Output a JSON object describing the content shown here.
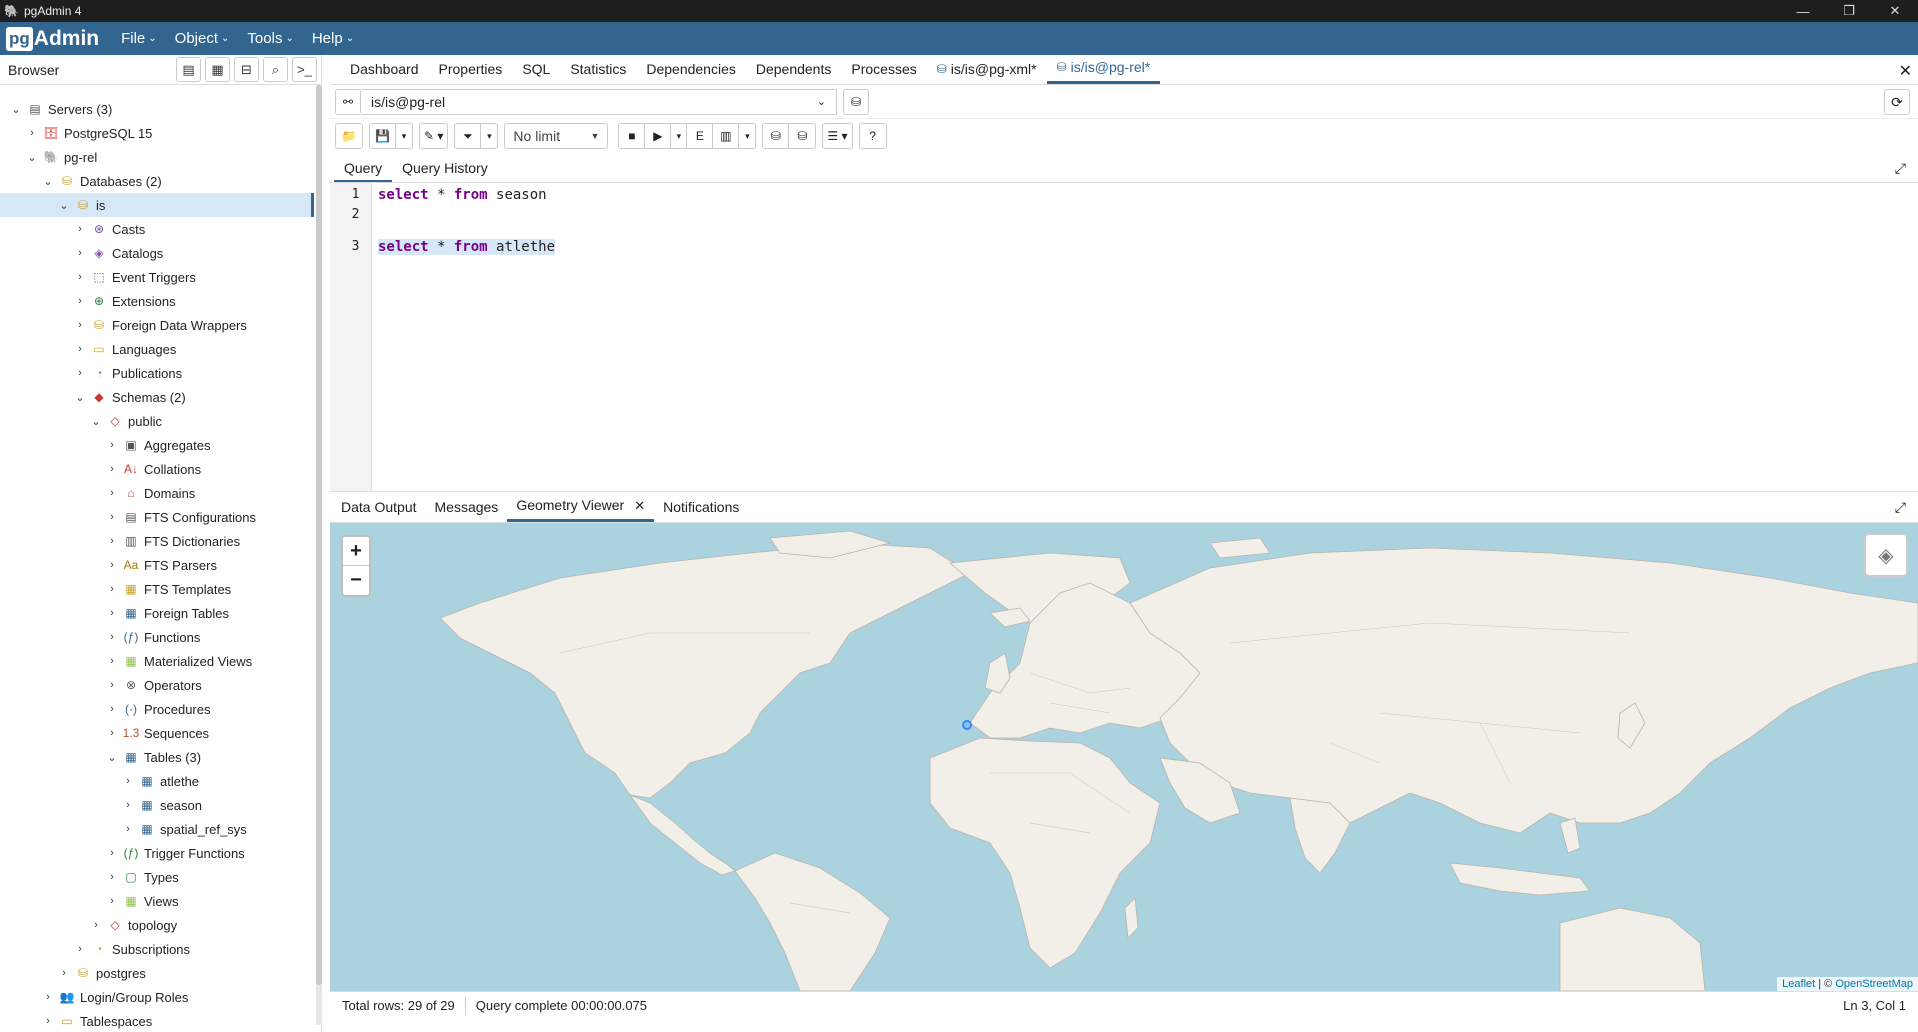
{
  "window": {
    "title": "pgAdmin 4",
    "controls": [
      "minimize-icon",
      "restore-icon",
      "close-icon"
    ]
  },
  "menubar": {
    "logo_pg": "pg",
    "logo_admin": "Admin",
    "items": [
      "File",
      "Object",
      "Tools",
      "Help"
    ]
  },
  "browser": {
    "title": "Browser",
    "tree": [
      {
        "label": "Servers (3)",
        "toggle": "v",
        "icon": "servers-icon",
        "level": 0
      },
      {
        "label": "PostgreSQL 15",
        "toggle": ">",
        "icon": "server-disconnected-icon",
        "level": 1
      },
      {
        "label": "pg-rel",
        "toggle": "v",
        "icon": "server-icon",
        "level": 1
      },
      {
        "label": "Databases (2)",
        "toggle": "v",
        "icon": "databases-icon",
        "level": 2
      },
      {
        "label": "is",
        "toggle": "v",
        "icon": "database-icon",
        "level": 3,
        "selected": true
      },
      {
        "label": "Casts",
        "toggle": ">",
        "icon": "casts-icon",
        "level": 4
      },
      {
        "label": "Catalogs",
        "toggle": ">",
        "icon": "catalogs-icon",
        "level": 4
      },
      {
        "label": "Event Triggers",
        "toggle": ">",
        "icon": "event-triggers-icon",
        "level": 4
      },
      {
        "label": "Extensions",
        "toggle": ">",
        "icon": "extensions-icon",
        "level": 4
      },
      {
        "label": "Foreign Data Wrappers",
        "toggle": ">",
        "icon": "foreign-data-wrappers-icon",
        "level": 4
      },
      {
        "label": "Languages",
        "toggle": ">",
        "icon": "languages-icon",
        "level": 4
      },
      {
        "label": "Publications",
        "toggle": ">",
        "icon": "publications-icon",
        "level": 4
      },
      {
        "label": "Schemas (2)",
        "toggle": "v",
        "icon": "schemas-icon",
        "level": 4
      },
      {
        "label": "public",
        "toggle": "v",
        "icon": "schema-icon",
        "level": 5
      },
      {
        "label": "Aggregates",
        "toggle": ">",
        "icon": "aggregates-icon",
        "level": 6
      },
      {
        "label": "Collations",
        "toggle": ">",
        "icon": "collations-icon",
        "level": 6
      },
      {
        "label": "Domains",
        "toggle": ">",
        "icon": "domains-icon",
        "level": 6
      },
      {
        "label": "FTS Configurations",
        "toggle": ">",
        "icon": "fts-configurations-icon",
        "level": 6
      },
      {
        "label": "FTS Dictionaries",
        "toggle": ">",
        "icon": "fts-dictionaries-icon",
        "level": 6
      },
      {
        "label": "FTS Parsers",
        "toggle": ">",
        "icon": "fts-parsers-icon",
        "level": 6
      },
      {
        "label": "FTS Templates",
        "toggle": ">",
        "icon": "fts-templates-icon",
        "level": 6
      },
      {
        "label": "Foreign Tables",
        "toggle": ">",
        "icon": "foreign-tables-icon",
        "level": 6
      },
      {
        "label": "Functions",
        "toggle": ">",
        "icon": "functions-icon",
        "level": 6
      },
      {
        "label": "Materialized Views",
        "toggle": ">",
        "icon": "materialized-views-icon",
        "level": 6
      },
      {
        "label": "Operators",
        "toggle": ">",
        "icon": "operators-icon",
        "level": 6
      },
      {
        "label": "Procedures",
        "toggle": ">",
        "icon": "procedures-icon",
        "level": 6
      },
      {
        "label": "Sequences",
        "toggle": ">",
        "icon": "sequences-icon",
        "level": 6
      },
      {
        "label": "Tables (3)",
        "toggle": "v",
        "icon": "tables-icon",
        "level": 6
      },
      {
        "label": "atlethe",
        "toggle": ">",
        "icon": "table-icon",
        "level": 7
      },
      {
        "label": "season",
        "toggle": ">",
        "icon": "table-icon",
        "level": 7
      },
      {
        "label": "spatial_ref_sys",
        "toggle": ">",
        "icon": "table-icon",
        "level": 7
      },
      {
        "label": "Trigger Functions",
        "toggle": ">",
        "icon": "trigger-functions-icon",
        "level": 6
      },
      {
        "label": "Types",
        "toggle": ">",
        "icon": "types-icon",
        "level": 6
      },
      {
        "label": "Views",
        "toggle": ">",
        "icon": "views-icon",
        "level": 6
      },
      {
        "label": "topology",
        "toggle": ">",
        "icon": "schema-icon",
        "level": 5
      },
      {
        "label": "Subscriptions",
        "toggle": ">",
        "icon": "subscriptions-icon",
        "level": 4
      },
      {
        "label": "postgres",
        "toggle": ">",
        "icon": "database-icon",
        "level": 3
      },
      {
        "label": "Login/Group Roles",
        "toggle": ">",
        "icon": "roles-icon",
        "level": 2
      },
      {
        "label": "Tablespaces",
        "toggle": ">",
        "icon": "tablespaces-icon",
        "level": 2
      }
    ]
  },
  "main_tabs": [
    {
      "label": "Dashboard"
    },
    {
      "label": "Properties"
    },
    {
      "label": "SQL"
    },
    {
      "label": "Statistics"
    },
    {
      "label": "Dependencies"
    },
    {
      "label": "Dependents"
    },
    {
      "label": "Processes"
    },
    {
      "label": "is/is@pg-xml*",
      "icon": "query-tool-icon"
    },
    {
      "label": "is/is@pg-rel*",
      "icon": "query-tool-icon",
      "active": true
    }
  ],
  "connection": {
    "value": "is/is@pg-rel"
  },
  "toolbar": {
    "limit": "No limit"
  },
  "editor_tabs": [
    {
      "label": "Query",
      "active": true
    },
    {
      "label": "Query History"
    }
  ],
  "editor": {
    "line_numbers": [
      "1",
      "2",
      "3"
    ],
    "lines": [
      {
        "parts": [
          {
            "t": "select",
            "kw": true
          },
          {
            "t": " * "
          },
          {
            "t": "from",
            "kw": true
          },
          {
            "t": " season"
          }
        ],
        "hl": false
      },
      {
        "parts": [],
        "hl": false
      },
      {
        "parts": [
          {
            "t": "select",
            "kw": true
          },
          {
            "t": " * "
          },
          {
            "t": "from",
            "kw": true
          },
          {
            "t": " atlethe"
          }
        ],
        "hl": true
      }
    ]
  },
  "result_tabs": [
    {
      "label": "Data Output"
    },
    {
      "label": "Messages"
    },
    {
      "label": "Geometry Viewer",
      "active": true,
      "closable": true
    },
    {
      "label": "Notifications"
    }
  ],
  "map": {
    "zoom_in": "+",
    "zoom_out": "−",
    "attribution_leaflet": "Leaflet",
    "attribution_sep": " | © ",
    "attribution_osm": "OpenStreetMap",
    "marker": {
      "lon": 2.2,
      "lat": 41.4
    }
  },
  "status": {
    "total_rows": "Total rows: 29 of 29",
    "query_complete": "Query complete 00:00:00.075",
    "cursor": "Ln 3, Col 1"
  },
  "colors": {
    "brand": "#326690",
    "water": "#aad3df",
    "land": "#f2efe9",
    "selection": "#d6e8f7"
  }
}
